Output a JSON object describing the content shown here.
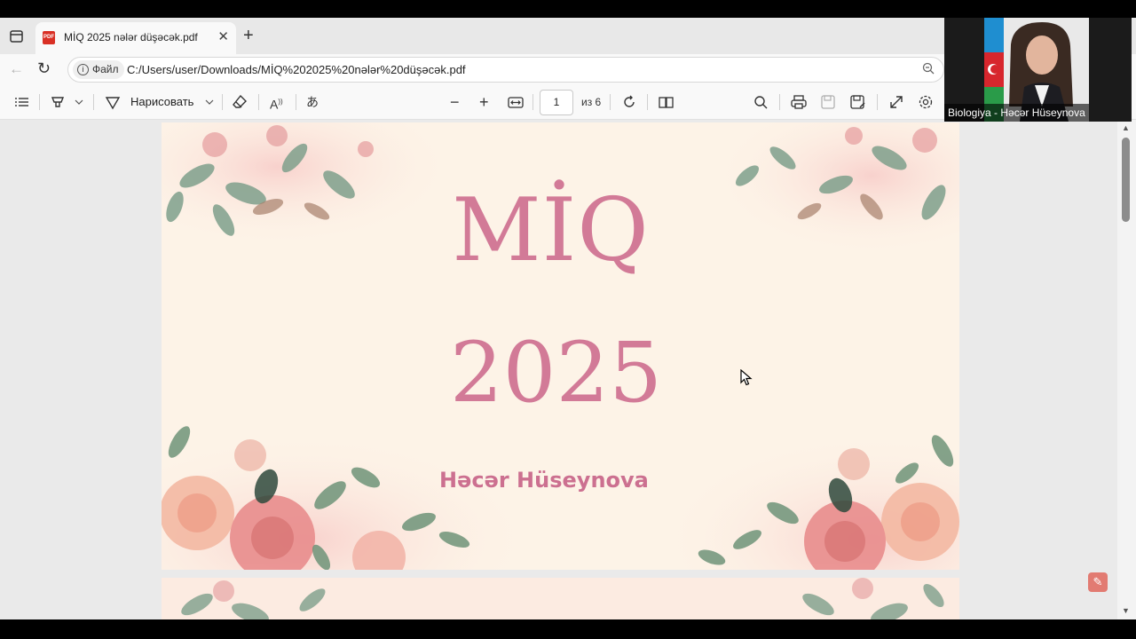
{
  "browser": {
    "tab_title": "MİQ 2025 nələr düşəcək.pdf",
    "tab_close": "✕",
    "new_tab": "+",
    "site_info_label": "Файл",
    "url": "C:/Users/user/Downloads/MİQ%202025%20nələr%20düşəcək.pdf"
  },
  "pdf_toolbar": {
    "draw_label": "Нарисовать",
    "page_number": "1",
    "page_count": "из 6"
  },
  "document": {
    "title": "MİQ",
    "year": "2025",
    "author": "Həcər Hüseynova"
  },
  "webcam": {
    "caption": "Biologiya - Həcər Hüseynova"
  },
  "icons": [
    "tab-actions-icon",
    "pdf-file-icon",
    "back-arrow-icon",
    "reload-icon",
    "info-icon",
    "zoom-out-icon",
    "contents-icon",
    "highlight-icon",
    "chevron-down-icon",
    "draw-icon",
    "eraser-icon",
    "read-aloud-icon",
    "translate-icon",
    "minus-icon",
    "plus-icon",
    "fit-width-icon",
    "rotate-icon",
    "page-view-icon",
    "search-icon",
    "print-icon",
    "save-icon",
    "save-as-icon",
    "fullscreen-icon",
    "settings-icon",
    "acrobat-icon",
    "cursor-icon"
  ]
}
